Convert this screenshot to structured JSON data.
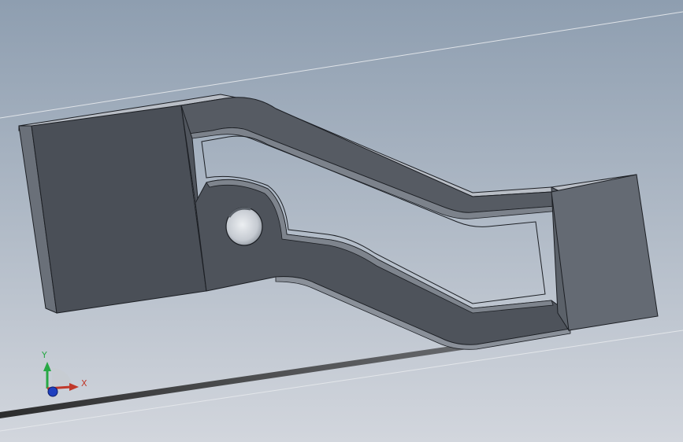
{
  "viewport": {
    "background_top": "#8e9eb0",
    "background_bottom": "#d2d6dd",
    "part_face_color": "#4a4f57",
    "part_side_color": "#5e646d",
    "part_edge_color": "#1c1f24",
    "highlight_color": "#b9bec6"
  },
  "triad": {
    "x_label": "X",
    "y_label": "Y",
    "x_color": "#c0392b",
    "y_color": "#27a845",
    "z_color": "#1f3fbf"
  }
}
